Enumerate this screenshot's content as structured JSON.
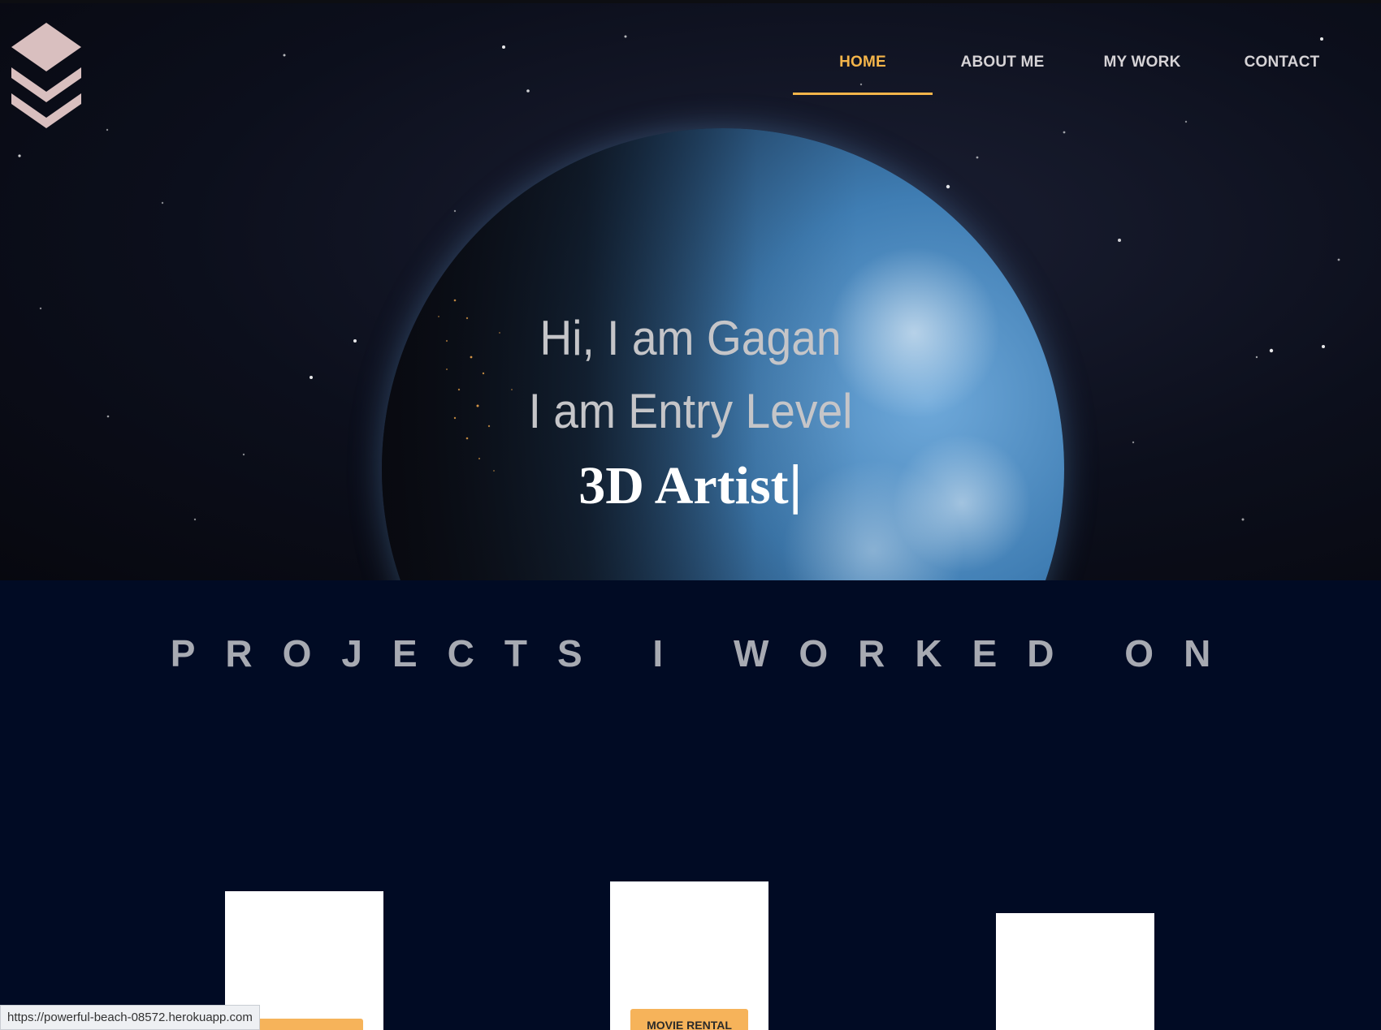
{
  "header": {
    "logo_icon": "layers-icon",
    "nav": [
      {
        "label": "HOME",
        "active": true
      },
      {
        "label": "ABOUT ME",
        "active": false
      },
      {
        "label": "MY WORK",
        "active": false
      },
      {
        "label": "CONTACT",
        "active": false
      }
    ]
  },
  "hero": {
    "line1": "Hi, I am Gagan",
    "line2": "I am Entry Level",
    "role": "3D Artist",
    "cursor": "|"
  },
  "projects": {
    "title": "PROJECTS I WORKED ON",
    "cards": [
      {
        "button_label": ""
      },
      {
        "button_label": "MOVIE RENTAL"
      },
      {
        "button_label": ""
      }
    ]
  },
  "status_bar": {
    "url": "https://powerful-beach-08572.herokuapp.com"
  },
  "colors": {
    "accent": "#f5b54a",
    "background": "#010b24",
    "logo": "#d9bfbf"
  }
}
